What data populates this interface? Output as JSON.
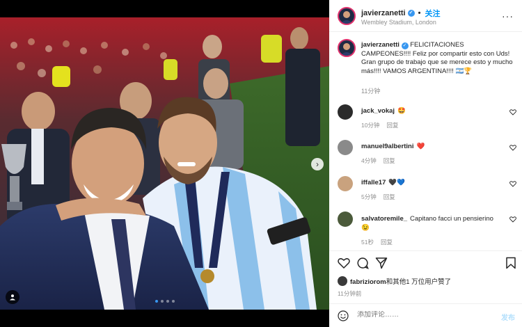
{
  "post": {
    "username": "javierzanetti",
    "verified_mark": "✓",
    "separator": "•",
    "follow_label": "关注",
    "location": "Wembley Stadium, London",
    "more_label": "···",
    "photo_alt": "Selfie of two men in a stadium, one in a suit and one in an Argentina jersey with a medal",
    "carousel": {
      "count": 4,
      "active_index": 0
    }
  },
  "caption": {
    "username": "javierzanetti",
    "text": "FELICITACIONES CAMPEONES!!!! Feliz por compartir esto con Uds! Gran grupo de trabajo que se merece esto y mucho más!!!! VAMOS ARGENTINA!!!! 🇦🇷🏆",
    "time": "11分钟"
  },
  "comments": [
    {
      "username": "jack_vokaj",
      "text": "🤩",
      "time": "10分钟",
      "reply": "回复",
      "avatar_color": "#2b2b2b"
    },
    {
      "username": "manuel9albertini",
      "text": "❤️",
      "time": "4分钟",
      "reply": "回复",
      "avatar_color": "#8a8a8a"
    },
    {
      "username": "iffalle17",
      "text": "🖤💙",
      "time": "5分钟",
      "reply": "回复",
      "avatar_color": "#c9a27e"
    },
    {
      "username": "salvatoremile_",
      "text": "Capitano facci un pensierino 😉",
      "time": "51秒",
      "reply": "回复",
      "avatar_color": "#4b5a3a"
    }
  ],
  "likes": {
    "username": "fabriziorom",
    "text": "和其他1 万位用户赞了"
  },
  "post_time": "11分钟前",
  "add_comment": {
    "placeholder": "添加评论……",
    "post_label": "发布"
  },
  "colors": {
    "accent": "#0095f6",
    "verified": "#3897f0",
    "heart_red": "#ed4956"
  },
  "icons": [
    "heart-icon",
    "comment-icon",
    "share-icon",
    "bookmark-icon",
    "emoji-icon",
    "user-tag-icon",
    "chevron-right-icon"
  ]
}
